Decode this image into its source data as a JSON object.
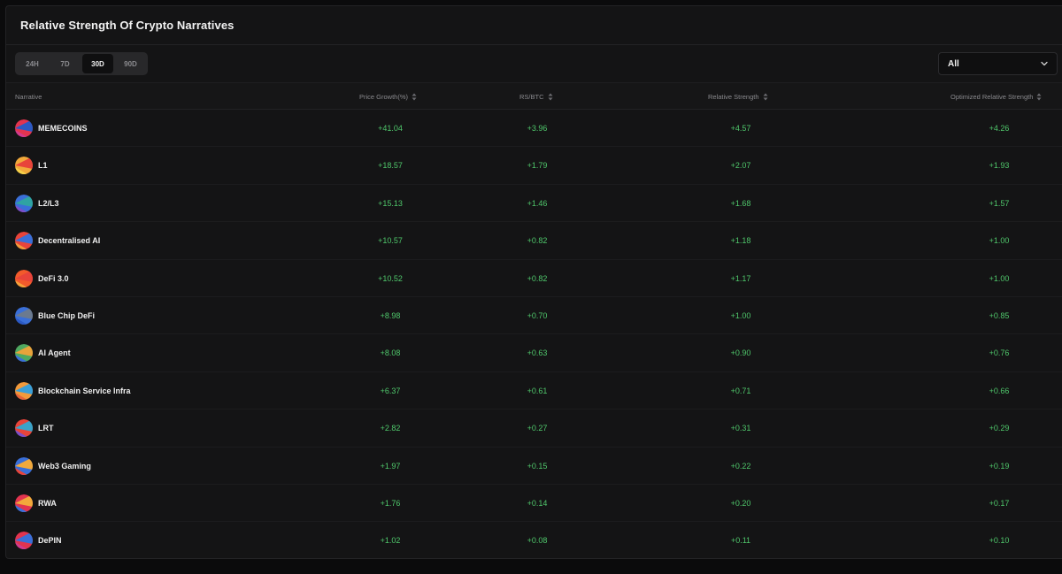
{
  "title": "Relative Strength Of Crypto Narratives",
  "tabs": [
    {
      "label": "24H",
      "active": false
    },
    {
      "label": "7D",
      "active": false
    },
    {
      "label": "30D",
      "active": true
    },
    {
      "label": "90D",
      "active": false
    }
  ],
  "filter": {
    "selected": "All"
  },
  "columns": [
    "Narrative",
    "Price Growth(%)",
    "RS/BTC",
    "Relative Strength",
    "Optimized Relative Strength"
  ],
  "colors": {
    "positive": "#4fc76b"
  },
  "rows": [
    {
      "name": "MEMECOINS",
      "price_growth": "+41.04",
      "rs_btc": "+3.96",
      "relative_strength": "+4.57",
      "optimized": "+4.26"
    },
    {
      "name": "L1",
      "price_growth": "+18.57",
      "rs_btc": "+1.79",
      "relative_strength": "+2.07",
      "optimized": "+1.93"
    },
    {
      "name": "L2/L3",
      "price_growth": "+15.13",
      "rs_btc": "+1.46",
      "relative_strength": "+1.68",
      "optimized": "+1.57"
    },
    {
      "name": "Decentralised AI",
      "price_growth": "+10.57",
      "rs_btc": "+0.82",
      "relative_strength": "+1.18",
      "optimized": "+1.00"
    },
    {
      "name": "DeFi 3.0",
      "price_growth": "+10.52",
      "rs_btc": "+0.82",
      "relative_strength": "+1.17",
      "optimized": "+1.00"
    },
    {
      "name": "Blue Chip DeFi",
      "price_growth": "+8.98",
      "rs_btc": "+0.70",
      "relative_strength": "+1.00",
      "optimized": "+0.85"
    },
    {
      "name": "AI Agent",
      "price_growth": "+8.08",
      "rs_btc": "+0.63",
      "relative_strength": "+0.90",
      "optimized": "+0.76"
    },
    {
      "name": "Blockchain Service Infra",
      "price_growth": "+6.37",
      "rs_btc": "+0.61",
      "relative_strength": "+0.71",
      "optimized": "+0.66"
    },
    {
      "name": "LRT",
      "price_growth": "+2.82",
      "rs_btc": "+0.27",
      "relative_strength": "+0.31",
      "optimized": "+0.29"
    },
    {
      "name": "Web3 Gaming",
      "price_growth": "+1.97",
      "rs_btc": "+0.15",
      "relative_strength": "+0.22",
      "optimized": "+0.19"
    },
    {
      "name": "RWA",
      "price_growth": "+1.76",
      "rs_btc": "+0.14",
      "relative_strength": "+0.20",
      "optimized": "+0.17"
    },
    {
      "name": "DePIN",
      "price_growth": "+1.02",
      "rs_btc": "+0.08",
      "relative_strength": "+0.11",
      "optimized": "+0.10"
    }
  ]
}
